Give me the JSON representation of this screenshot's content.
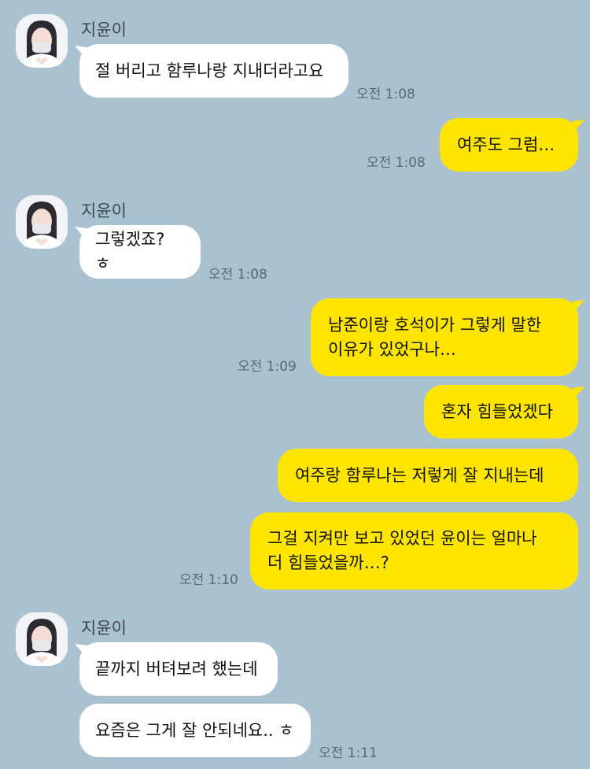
{
  "chat": {
    "groups": [
      {
        "sender": "지윤이",
        "messages": [
          "절 버리고 함루나랑 지내더라고요"
        ],
        "time": "오전 1:08"
      },
      {
        "messages": [
          "여주도 그럼…"
        ],
        "time": "오전 1:08"
      },
      {
        "sender": "지윤이",
        "messages": [
          "그렇겠죠? ㅎ"
        ],
        "time": "오전 1:08"
      },
      {
        "messages": [
          "남준이랑 호석이가 그렇게 말한\n이유가 있었구나…"
        ],
        "time": "오전 1:09"
      },
      {
        "messages": [
          "혼자 힘들었겠다",
          "여주랑 함루나는 저렇게 잘 지내는데",
          "그걸 지켜만 보고 있었던 윤이는 얼마나\n더 힘들었을까…?"
        ],
        "time": "오전 1:10"
      },
      {
        "sender": "지윤이",
        "messages": [
          "끝까지 버텨보려 했는데",
          "요즘은 그게 잘 안되네요.. ㅎ"
        ],
        "time": "오전 1:11"
      }
    ]
  },
  "colors": {
    "background": "#aac1d0",
    "my_bubble": "#fee500",
    "their_bubble": "#ffffff"
  }
}
